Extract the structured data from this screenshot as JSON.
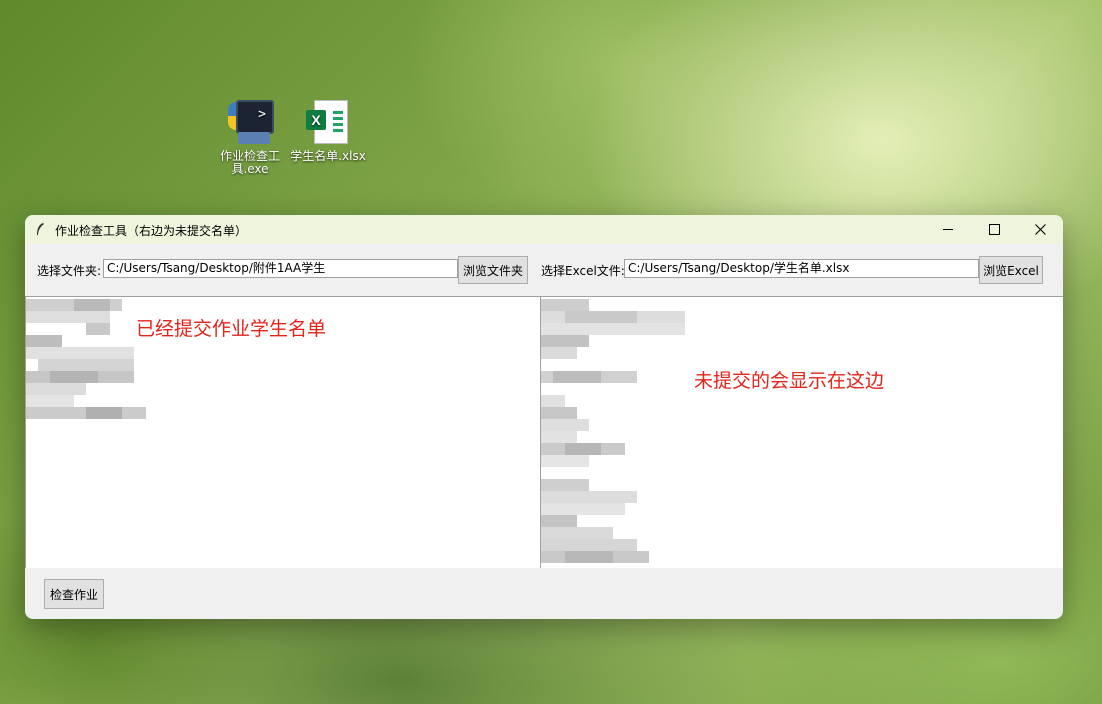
{
  "desktop": {
    "icons": [
      {
        "label": "作业检查工具.exe",
        "icon": "python-exe-icon"
      },
      {
        "label": "学生名单.xlsx",
        "icon": "excel-file-icon"
      }
    ]
  },
  "window": {
    "title": "作业检查工具（右边为未提交名单）",
    "controls": {
      "minimize": "minimize-icon",
      "maximize": "maximize-icon",
      "close": "close-icon"
    },
    "folder": {
      "label": "选择文件夹:",
      "value": "C:/Users/Tsang/Desktop/附件1AA学生",
      "browse_label": "浏览文件夹"
    },
    "excel": {
      "label": "选择Excel文件:",
      "value": "C:/Users/Tsang/Desktop/学生名单.xlsx",
      "browse_label": "浏览Excel"
    },
    "left_panel": {
      "annotation": "已经提交作业学生名单"
    },
    "right_panel": {
      "annotation": "未提交的会显示在这边"
    },
    "check_button_label": "检查作业"
  },
  "colors": {
    "annotation": "#e3241b",
    "titlebar": "#eef5dc",
    "window_bg": "#f0f0f0"
  }
}
